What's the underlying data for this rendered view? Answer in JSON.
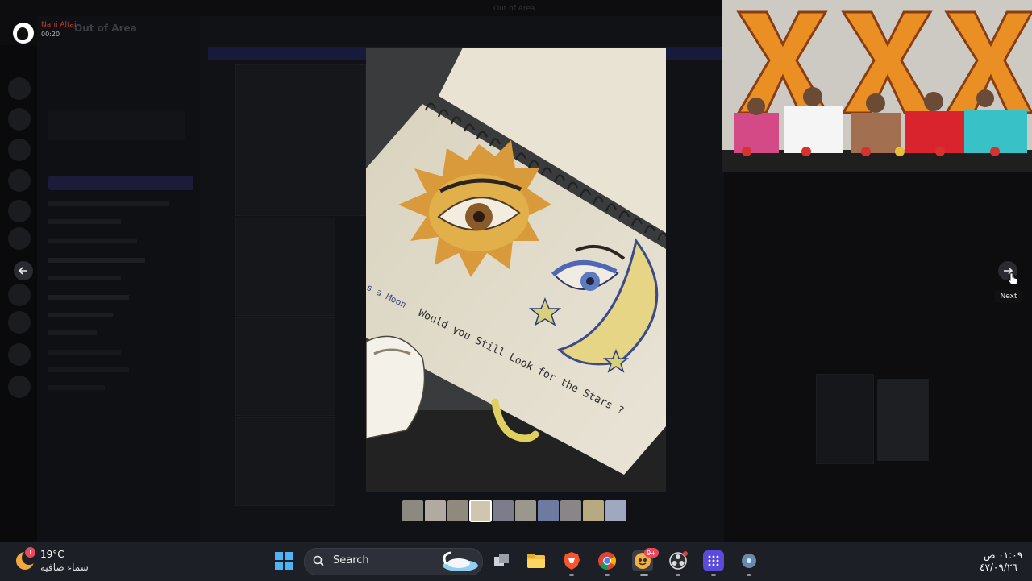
{
  "window_title": "Out of Area",
  "server_name": "Out of Area",
  "caller": {
    "name": "Nani Altai",
    "duration": "00:20"
  },
  "viewer": {
    "prev_icon": "arrow-left-icon",
    "next_icon": "arrow-right-icon",
    "next_tooltip": "Next",
    "thumbnail_count": 10,
    "selected_thumbnail": 4,
    "image_text": {
      "sun_moon_label": "s a Moon",
      "caption": "Would you Still Look for the Stars ?"
    }
  },
  "taskbar": {
    "weather": {
      "badge": "1",
      "temperature": "19°C",
      "condition": "سماء صافية"
    },
    "search_label": "Search",
    "apps": [
      "start-icon",
      "search-icon",
      "task-view-icon",
      "file-explorer-icon",
      "brave-icon",
      "chrome-icon",
      "discord-icon",
      "obs-icon",
      "launcher-icon",
      "settings-icon"
    ],
    "discord_badge": "9+",
    "clock_time": "٠١:٠٩ ص",
    "clock_date": "٤٧/٠٩/٢٦"
  },
  "colors": {
    "accent": "#5865f2",
    "taskbar_bg": "#1c1f26",
    "video_x": "#e98f23"
  }
}
